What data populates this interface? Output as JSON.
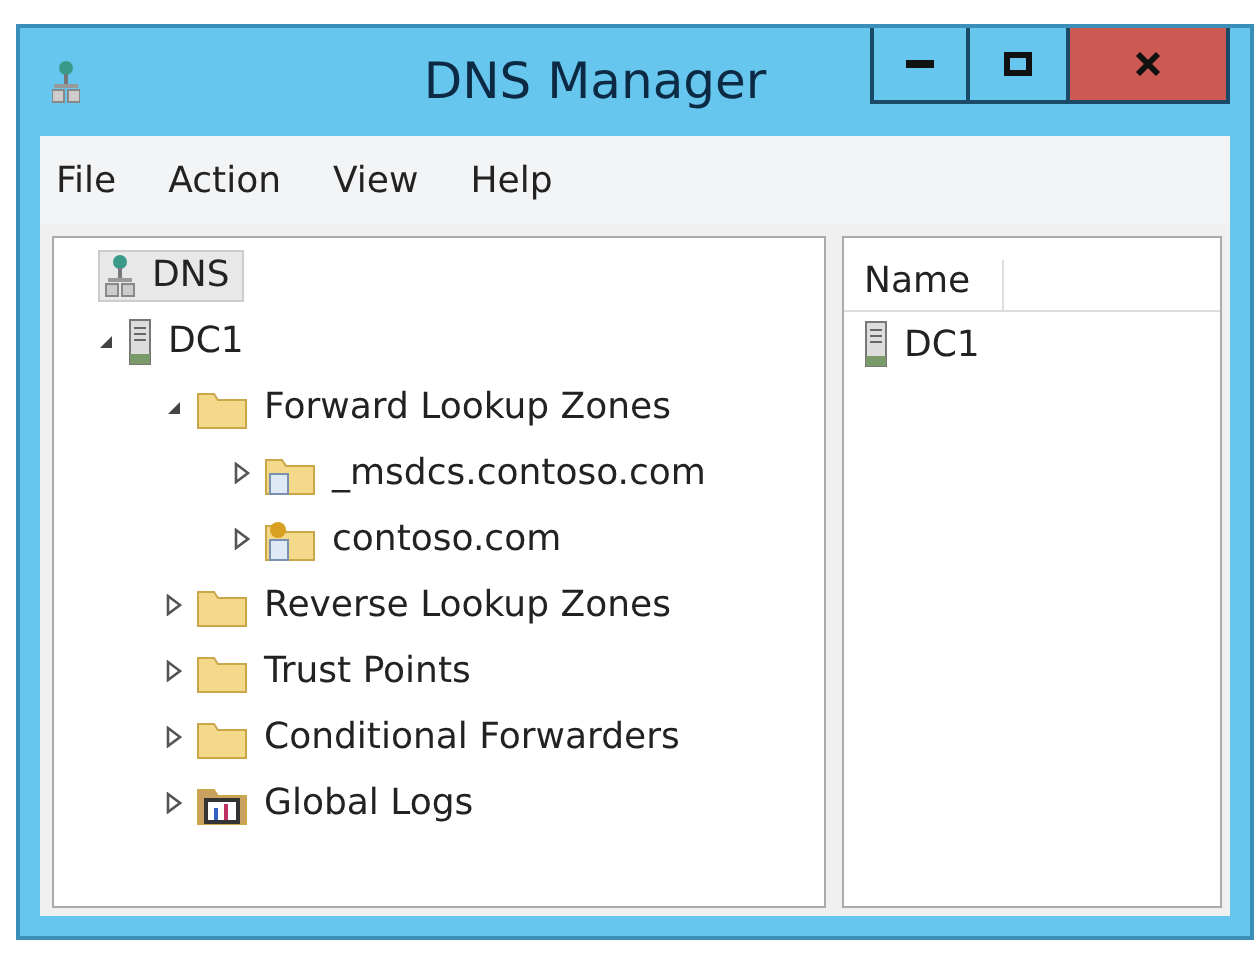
{
  "window": {
    "title": "DNS Manager"
  },
  "menu": [
    "File",
    "Action",
    "View",
    "Help"
  ],
  "tree": [
    {
      "label": "DNS",
      "kind": "dns",
      "selected": true,
      "children": [
        {
          "label": "DC1",
          "kind": "server",
          "selected": false,
          "expanded": true,
          "children": [
            {
              "label": "Forward Lookup Zones",
              "kind": "folder",
              "selected": false,
              "expanded": true,
              "children": [
                {
                  "label": "_msdcs.contoso.com",
                  "kind": "zone",
                  "selected": false,
                  "expanded": false
                },
                {
                  "label": "contoso.com",
                  "kind": "secure-zone",
                  "selected": false,
                  "expanded": false
                }
              ]
            },
            {
              "label": "Reverse Lookup Zones",
              "kind": "folder",
              "selected": false,
              "expanded": false
            },
            {
              "label": "Trust Points",
              "kind": "folder",
              "selected": false,
              "expanded": false
            },
            {
              "label": "Conditional Forwarders",
              "kind": "folder",
              "selected": false,
              "expanded": false
            },
            {
              "label": "Global Logs",
              "kind": "logs",
              "selected": false,
              "expanded": false
            }
          ]
        }
      ]
    }
  ],
  "list": {
    "columns": [
      "Name"
    ],
    "rows": [
      {
        "name": "DC1",
        "kind": "server"
      }
    ]
  }
}
